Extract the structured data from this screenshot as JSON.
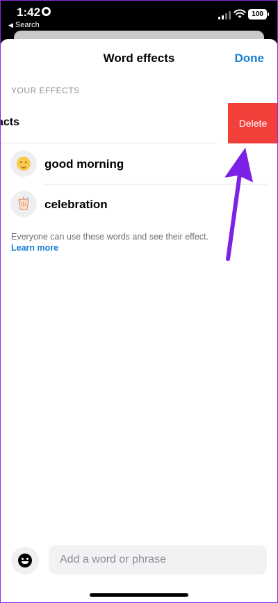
{
  "status_bar": {
    "time": "1:42",
    "back_label": "Search",
    "battery": "100"
  },
  "sheet": {
    "title": "Word effects",
    "done_label": "Done",
    "section_header": "YOUR EFFECTS",
    "swiped_item": {
      "label_visible": "acts",
      "delete_label": "Delete"
    },
    "effects": [
      {
        "label": "good morning",
        "icon": "sun-face-icon"
      },
      {
        "label": "celebration",
        "icon": "party-icon"
      }
    ],
    "footnote": "Everyone can use these words and see their effect.",
    "learn_more": "Learn more"
  },
  "composer": {
    "placeholder": "Add a word or phrase",
    "value": ""
  },
  "colors": {
    "accent": "#1a7fd4",
    "delete": "#f23f3a",
    "annotation_arrow": "#7b22e6"
  }
}
